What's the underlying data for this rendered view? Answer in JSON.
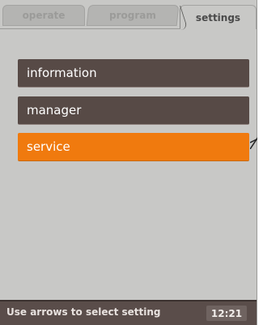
{
  "tabs": [
    {
      "label": "operate",
      "active": false
    },
    {
      "label": "program",
      "active": false
    },
    {
      "label": "settings",
      "active": true
    }
  ],
  "menu": {
    "items": [
      {
        "label": "information",
        "selected": false
      },
      {
        "label": "manager",
        "selected": false
      },
      {
        "label": "service",
        "selected": true
      }
    ]
  },
  "status": {
    "hint": "Use arrows to select setting",
    "time": "12:21"
  },
  "colors": {
    "screen_bg": "#c8c8c6",
    "item_bg": "#574a46",
    "selected_bg": "#f07a0e",
    "status_bg": "#5a4d4a"
  }
}
